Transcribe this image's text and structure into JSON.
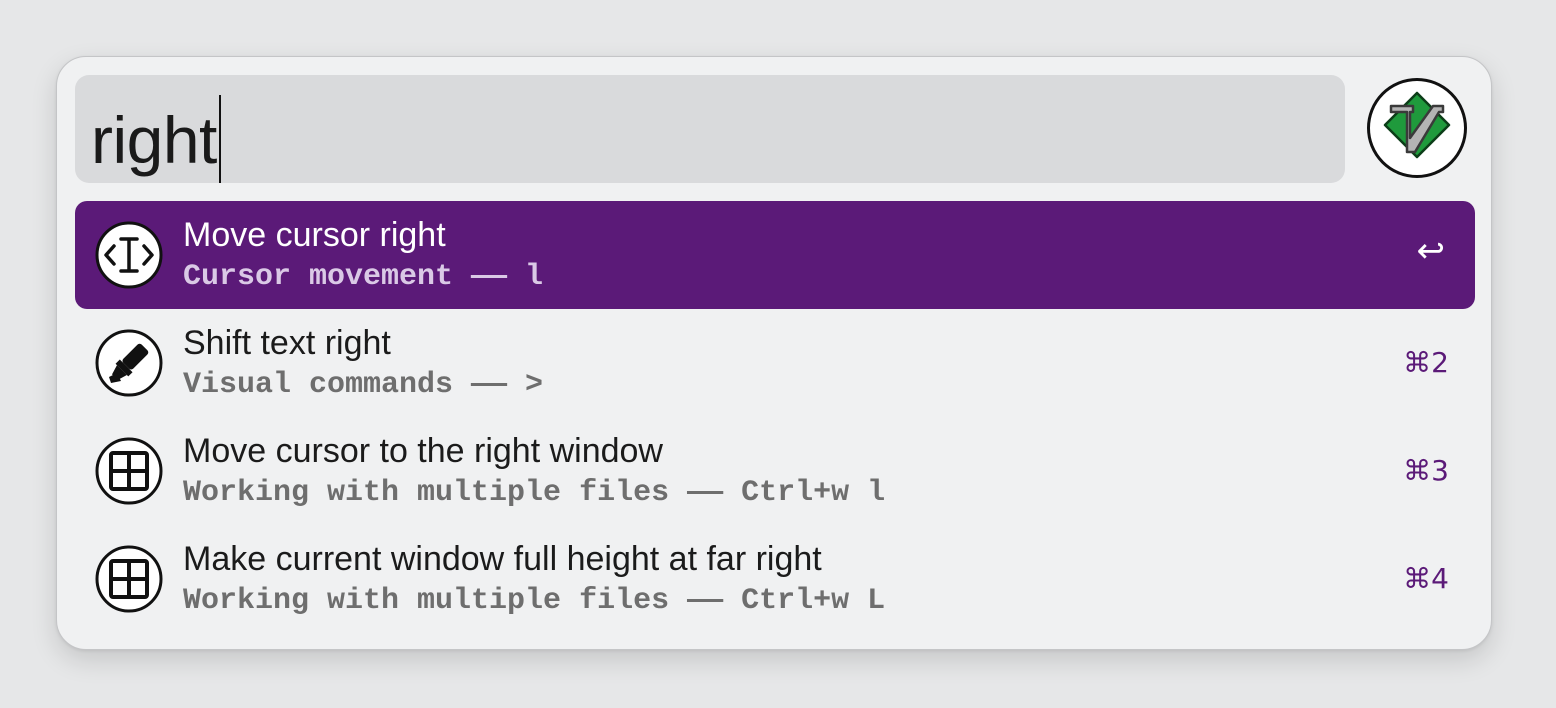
{
  "search": {
    "query": "right"
  },
  "app_icon": {
    "name": "vim-logo-icon",
    "colors": {
      "accent": "#1f9a3c",
      "secondary": "#9a9a9a"
    }
  },
  "theme": {
    "selected_background": "#5b1a78",
    "shortcut_color": "#5b1a78"
  },
  "results": [
    {
      "title": "Move cursor right",
      "subtitle": "Cursor movement —— l",
      "shortcut": "↩",
      "icon": "text-cursor-icon",
      "selected": true
    },
    {
      "title": "Shift text right",
      "subtitle": "Visual commands —— >",
      "shortcut": "⌘2",
      "icon": "highlighter-icon",
      "selected": false
    },
    {
      "title": "Move cursor to the right window",
      "subtitle": "Working with multiple files —— Ctrl+w l",
      "shortcut": "⌘3",
      "icon": "window-grid-icon",
      "selected": false
    },
    {
      "title": "Make current window full height at far right",
      "subtitle": "Working with multiple files —— Ctrl+w L",
      "shortcut": "⌘4",
      "icon": "window-grid-icon",
      "selected": false
    }
  ]
}
